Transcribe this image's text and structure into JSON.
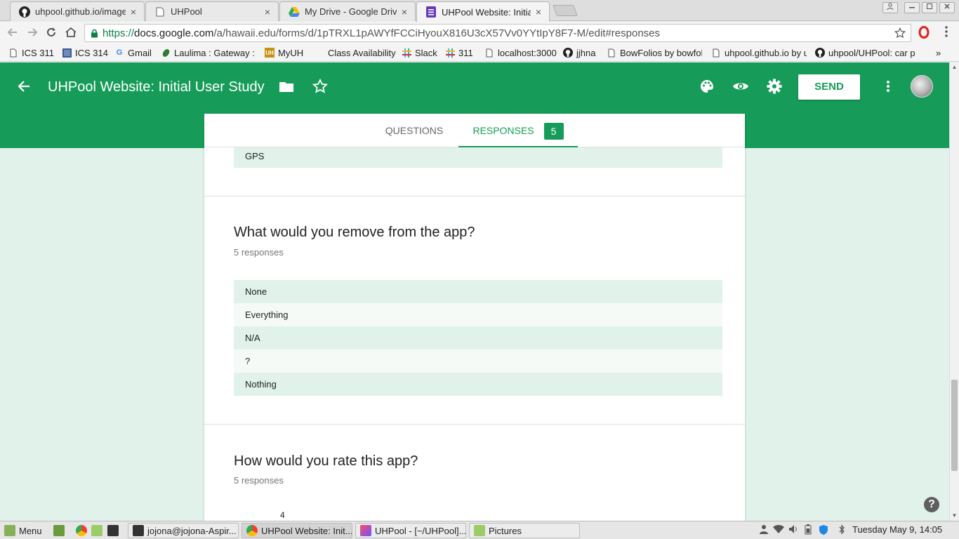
{
  "browser": {
    "tabs": [
      {
        "title": "uhpool.github.io/images/",
        "icon": "github-icon"
      },
      {
        "title": "UHPool",
        "icon": "page-icon"
      },
      {
        "title": "My Drive - Google Drive",
        "icon": "google-drive-icon"
      },
      {
        "title": "UHPool Website: Initial U",
        "icon": "google-forms-icon"
      }
    ],
    "close_glyph": "×",
    "url_secure": "https://",
    "url_host": "docs.google.com",
    "url_rest": "/a/hawaii.edu/forms/d/1pTRXL1pAWYfFCCiHyouX816U3cX57Vv0YYtIpY8F7-M/edit#responses",
    "bookmarks": [
      {
        "label": "ICS 311",
        "icon": "page-icon"
      },
      {
        "label": "ICS 314",
        "icon": "square-icon"
      },
      {
        "label": "Gmail",
        "icon": "google-g-icon"
      },
      {
        "label": "Laulima : Gateway : W",
        "icon": "leaf-icon"
      },
      {
        "label": "MyUH",
        "icon": "uh-icon"
      },
      {
        "label": "Class Availability",
        "icon": "blank-icon"
      },
      {
        "label": "Slack",
        "icon": "slack-icon"
      },
      {
        "label": "311",
        "icon": "slack-icon"
      },
      {
        "label": "localhost:3000",
        "icon": "page-icon"
      },
      {
        "label": "jjhna",
        "icon": "github-icon"
      },
      {
        "label": "BowFolios by bowfolio",
        "icon": "page-icon"
      },
      {
        "label": "uhpool.github.io by uh",
        "icon": "page-icon"
      },
      {
        "label": "uhpool/UHPool: car p",
        "icon": "github-icon"
      }
    ],
    "bookmarks_overflow": "»"
  },
  "form": {
    "title": "UHPool Website: Initial User Study",
    "send_label": "SEND",
    "tabs": {
      "questions": "QUESTIONS",
      "responses": "RESPONSES",
      "response_count": "5"
    },
    "prev_answer": "GPS",
    "question1": {
      "title": "What would you remove from the app?",
      "count": "5 responses",
      "answers": [
        "None",
        "Everything",
        "N/A",
        "?",
        "Nothing"
      ]
    },
    "question2": {
      "title": "How would you rate this app?",
      "count": "5 responses",
      "chart_label": "4"
    },
    "help_glyph": "?"
  },
  "taskbar": {
    "menu_label": "Menu",
    "windows": [
      {
        "label": "jojona@jojona-Aspir..."
      },
      {
        "label": "UHPool Website: Init..."
      },
      {
        "label": "UHPool - [~/UHPool]..."
      },
      {
        "label": "Pictures"
      }
    ],
    "clock": "Tuesday May  9, 14:05"
  },
  "colors": {
    "brand": "#169c58",
    "page_bg": "#e0f2ea",
    "row_shade": "#e0f2ea"
  }
}
